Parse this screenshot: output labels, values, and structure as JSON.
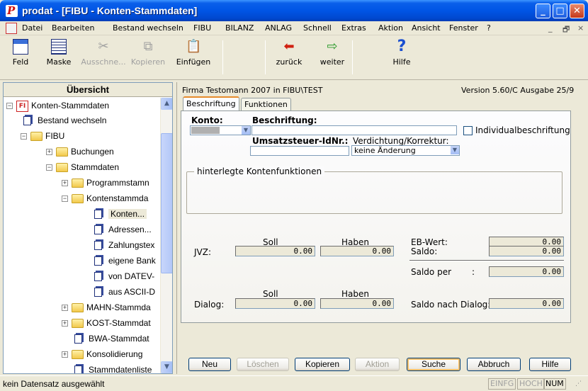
{
  "window": {
    "title": "prodat - [FIBU - Konten-Stammdaten]",
    "app_icon_letter": "P",
    "controls": [
      "_",
      "□",
      "✕"
    ]
  },
  "menu": {
    "items": [
      "Datei",
      "Bearbeiten",
      "Bestand wechseln",
      "FIBU",
      "BILANZ",
      "ANLAG",
      "Schnell",
      "Extras",
      "Aktion",
      "Ansicht",
      "Fenster",
      "?"
    ],
    "mdi_controls": [
      "_",
      "🗗",
      "×"
    ]
  },
  "toolbar": {
    "feld": "Feld",
    "maske": "Maske",
    "ausschneiden": "Ausschne...",
    "kopieren": "Kopieren",
    "einfuegen": "Einfügen",
    "zurueck": "zurück",
    "weiter": "weiter",
    "hilfe": "Hilfe"
  },
  "tree": {
    "header": "Übersicht",
    "items": [
      "Konten-Stammdaten",
      "Bestand wechseln",
      "FIBU",
      "Buchungen",
      "Stammdaten",
      "Programmstamn",
      "Kontenstammda",
      "Konten...",
      "Adressen...",
      "Zahlungstex",
      "eigene Bank",
      "von DATEV-",
      "aus ASCII-D",
      "MAHN-Stammda",
      "KOST-Stammdat",
      "BWA-Stammdat",
      "Konsolidierung",
      "Stammdatenliste"
    ]
  },
  "header": {
    "firma": "Firma Testomann 2007 in FIBU\\TEST",
    "version": "Version 5.60/C Ausgabe 25/9"
  },
  "tabs": [
    "Beschriftung",
    "Funktionen"
  ],
  "form": {
    "konto_label": "Konto:",
    "beschriftung_label": "Beschriftung:",
    "individual_label": "Individualbeschriftung",
    "ustid_label": "Umsatzsteuer-IdNr.:",
    "verdichtung_label": "Verdichtung/Korrektur:",
    "verdichtung_value": "keine Änderung",
    "group_label": "hinterlegte Kontenfunktionen",
    "soll_label": "Soll",
    "haben_label": "Haben",
    "jvz_label": "JVZ:",
    "jvz_soll": "0.00",
    "jvz_haben": "0.00",
    "ebwert_label": "EB-Wert:",
    "ebwert_value": "0.00",
    "saldo_label": "Saldo:",
    "saldo_value": "0.00",
    "saldo_per_label": "Saldo per",
    "saldo_per_colon": ":",
    "saldo_per_value": "0.00",
    "dialog_soll_label": "Soll",
    "dialog_haben_label": "Haben",
    "dialog_label": "Dialog:",
    "dialog_soll": "0.00",
    "dialog_haben": "0.00",
    "saldo_dialog_label": "Saldo nach Dialog:",
    "saldo_dialog_value": "0.00"
  },
  "buttons": {
    "neu": "Neu",
    "loeschen": "Löschen",
    "kopieren": "Kopieren",
    "aktion": "Aktion",
    "suche": "Suche",
    "abbruch": "Abbruch",
    "hilfe": "Hilfe"
  },
  "status": {
    "text": "kein Datensatz ausgewählt",
    "einfg": "EINFG",
    "hoch": "HOCH",
    "num": "NUM"
  }
}
